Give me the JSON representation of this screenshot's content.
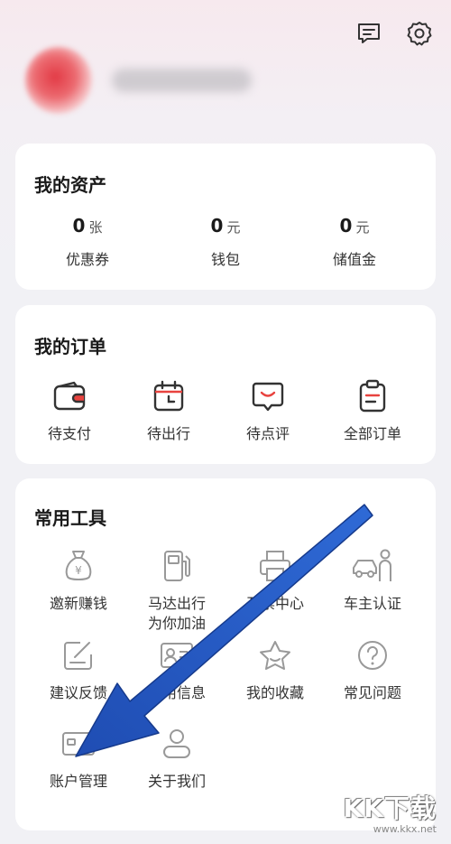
{
  "header": {
    "message_icon": "message-icon",
    "settings_icon": "gear-icon"
  },
  "profile": {
    "username": ""
  },
  "assets": {
    "title": "我的资产",
    "items": [
      {
        "value": "0",
        "unit": "张",
        "label": "优惠券"
      },
      {
        "value": "0",
        "unit": "元",
        "label": "钱包"
      },
      {
        "value": "0",
        "unit": "元",
        "label": "储值金"
      }
    ]
  },
  "orders": {
    "title": "我的订单",
    "items": [
      {
        "label": "待支付",
        "icon": "wallet-icon"
      },
      {
        "label": "待出行",
        "icon": "calendar-icon"
      },
      {
        "label": "待点评",
        "icon": "comment-icon"
      },
      {
        "label": "全部订单",
        "icon": "clipboard-icon"
      }
    ]
  },
  "tools": {
    "title": "常用工具",
    "items": [
      {
        "label": "邀新赚钱",
        "icon": "money-bag-icon"
      },
      {
        "label": "马达出行\n为你加油",
        "icon": "fuel-pump-icon"
      },
      {
        "label": "开票中心",
        "icon": "printer-icon"
      },
      {
        "label": "车主认证",
        "icon": "car-owner-icon"
      },
      {
        "label": "建议反馈",
        "icon": "feedback-icon"
      },
      {
        "label": "常用信息",
        "icon": "id-card-icon"
      },
      {
        "label": "我的收藏",
        "icon": "star-icon"
      },
      {
        "label": "常见问题",
        "icon": "question-icon"
      },
      {
        "label": "账户管理",
        "icon": "account-card-icon"
      },
      {
        "label": "关于我们",
        "icon": "about-icon"
      }
    ]
  },
  "watermark": {
    "main": "KK下载",
    "sub": "www.kkx.net"
  }
}
